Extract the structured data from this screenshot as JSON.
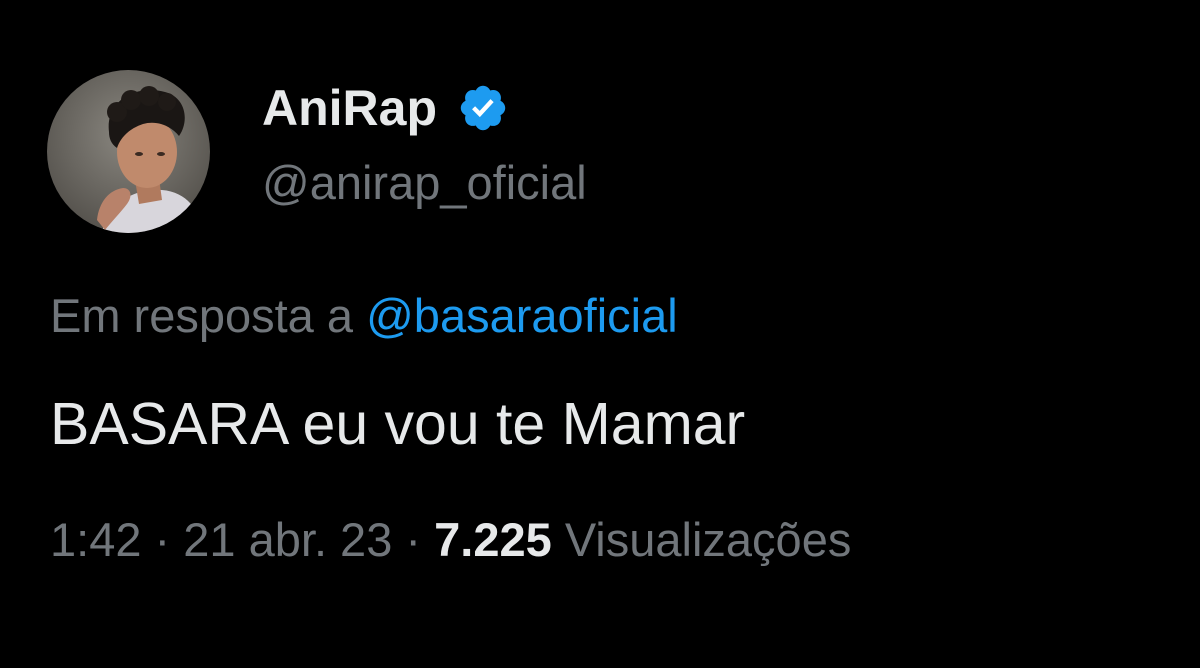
{
  "author": {
    "display_name": "AniRap",
    "handle": "@anirap_oficial",
    "verified_icon": "verified-badge-icon",
    "avatar": "profile-photo"
  },
  "reply": {
    "prefix": "Em resposta a",
    "mention": "@basaraoficial"
  },
  "tweet": {
    "text": "BASARA eu vou te Mamar"
  },
  "meta": {
    "time": "1:42",
    "separator": "·",
    "date": "21 abr. 23",
    "views_count": "7.225",
    "views_label": "Visualizações"
  },
  "colors": {
    "background": "#000000",
    "primary_text": "#e7e9ea",
    "secondary_text": "#71767b",
    "link": "#1d9bf0",
    "verified": "#1d9bf0"
  }
}
